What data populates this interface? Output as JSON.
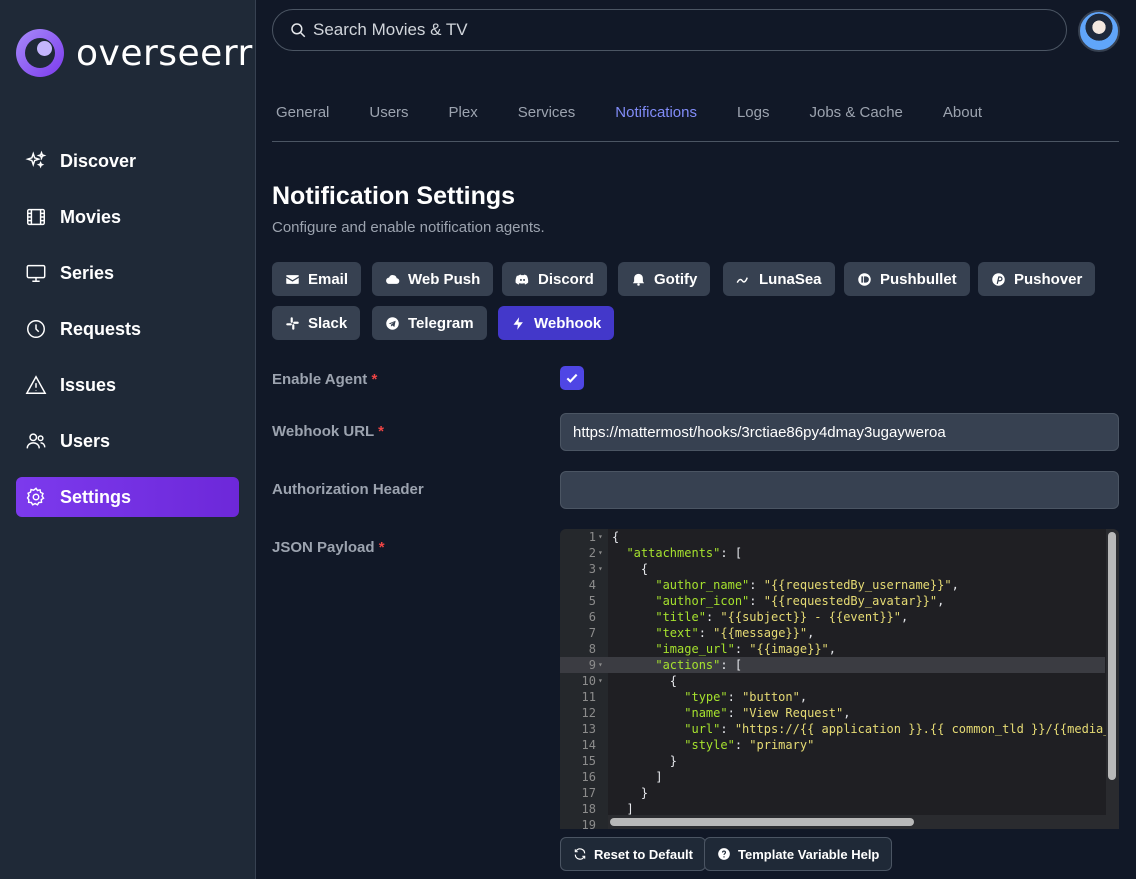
{
  "app": {
    "name": "overseerr"
  },
  "sidebar": {
    "items": [
      {
        "label": "Discover",
        "icon": "sparkles-icon"
      },
      {
        "label": "Movies",
        "icon": "film-icon"
      },
      {
        "label": "Series",
        "icon": "tv-icon"
      },
      {
        "label": "Requests",
        "icon": "clock-icon"
      },
      {
        "label": "Issues",
        "icon": "warning-icon"
      },
      {
        "label": "Users",
        "icon": "users-icon"
      },
      {
        "label": "Settings",
        "icon": "gear-icon",
        "active": true
      }
    ]
  },
  "search": {
    "placeholder": "Search Movies & TV"
  },
  "tabs": [
    {
      "label": "General"
    },
    {
      "label": "Users"
    },
    {
      "label": "Plex"
    },
    {
      "label": "Services"
    },
    {
      "label": "Notifications",
      "active": true
    },
    {
      "label": "Logs"
    },
    {
      "label": "Jobs & Cache"
    },
    {
      "label": "About"
    }
  ],
  "page": {
    "title": "Notification Settings",
    "subtitle": "Configure and enable notification agents."
  },
  "agents": [
    {
      "label": "Email",
      "icon": "mail-icon"
    },
    {
      "label": "Web Push",
      "icon": "cloud-icon"
    },
    {
      "label": "Discord",
      "icon": "discord-icon"
    },
    {
      "label": "Gotify",
      "icon": "gotify-icon"
    },
    {
      "label": "LunaSea",
      "icon": "lunasea-icon"
    },
    {
      "label": "Pushbullet",
      "icon": "pushbullet-icon"
    },
    {
      "label": "Pushover",
      "icon": "pushover-icon"
    },
    {
      "label": "Slack",
      "icon": "slack-icon"
    },
    {
      "label": "Telegram",
      "icon": "telegram-icon"
    },
    {
      "label": "Webhook",
      "icon": "lightning-icon",
      "active": true
    }
  ],
  "form": {
    "enable_agent": {
      "label": "Enable Agent",
      "required": "*",
      "checked": true
    },
    "webhook_url": {
      "label": "Webhook URL",
      "required": "*",
      "value": "https://mattermost/hooks/3rctiae86py4dmay3ugayweroa"
    },
    "authorization_header": {
      "label": "Authorization Header",
      "value": ""
    },
    "json_payload": {
      "label": "JSON Payload",
      "required": "*"
    }
  },
  "editor": {
    "highlighted_line": 9,
    "lines": [
      {
        "n": "1",
        "fold": "▾",
        "indent": "",
        "parts": [
          [
            "p",
            "{"
          ]
        ]
      },
      {
        "n": "2",
        "fold": "▾",
        "indent": "  ",
        "parts": [
          [
            "k",
            "\"attachments\""
          ],
          [
            "p",
            ": ["
          ]
        ]
      },
      {
        "n": "3",
        "fold": "▾",
        "indent": "    ",
        "parts": [
          [
            "p",
            "{"
          ]
        ]
      },
      {
        "n": "4",
        "fold": "",
        "indent": "      ",
        "parts": [
          [
            "k",
            "\"author_name\""
          ],
          [
            "p",
            ": "
          ],
          [
            "s",
            "\"{{requestedBy_username}}\""
          ],
          [
            "p",
            ","
          ]
        ]
      },
      {
        "n": "5",
        "fold": "",
        "indent": "      ",
        "parts": [
          [
            "k",
            "\"author_icon\""
          ],
          [
            "p",
            ": "
          ],
          [
            "s",
            "\"{{requestedBy_avatar}}\""
          ],
          [
            "p",
            ","
          ]
        ]
      },
      {
        "n": "6",
        "fold": "",
        "indent": "      ",
        "parts": [
          [
            "k",
            "\"title\""
          ],
          [
            "p",
            ": "
          ],
          [
            "s",
            "\"{{subject}} - {{event}}\""
          ],
          [
            "p",
            ","
          ]
        ]
      },
      {
        "n": "7",
        "fold": "",
        "indent": "      ",
        "parts": [
          [
            "k",
            "\"text\""
          ],
          [
            "p",
            ": "
          ],
          [
            "s",
            "\"{{message}}\""
          ],
          [
            "p",
            ","
          ]
        ]
      },
      {
        "n": "8",
        "fold": "",
        "indent": "      ",
        "parts": [
          [
            "k",
            "\"image_url\""
          ],
          [
            "p",
            ": "
          ],
          [
            "s",
            "\"{{image}}\""
          ],
          [
            "p",
            ","
          ]
        ]
      },
      {
        "n": "9",
        "fold": "▾",
        "indent": "      ",
        "parts": [
          [
            "k",
            "\"actions\""
          ],
          [
            "p",
            ": ["
          ]
        ]
      },
      {
        "n": "10",
        "fold": "▾",
        "indent": "        ",
        "parts": [
          [
            "p",
            "{"
          ]
        ]
      },
      {
        "n": "11",
        "fold": "",
        "indent": "          ",
        "parts": [
          [
            "k",
            "\"type\""
          ],
          [
            "p",
            ": "
          ],
          [
            "s",
            "\"button\""
          ],
          [
            "p",
            ","
          ]
        ]
      },
      {
        "n": "12",
        "fold": "",
        "indent": "          ",
        "parts": [
          [
            "k",
            "\"name\""
          ],
          [
            "p",
            ": "
          ],
          [
            "s",
            "\"View Request\""
          ],
          [
            "p",
            ","
          ]
        ]
      },
      {
        "n": "13",
        "fold": "",
        "indent": "          ",
        "parts": [
          [
            "k",
            "\"url\""
          ],
          [
            "p",
            ": "
          ],
          [
            "s",
            "\"https://{{ application }}.{{ common_tld }}/{{media_"
          ]
        ]
      },
      {
        "n": "14",
        "fold": "",
        "indent": "          ",
        "parts": [
          [
            "k",
            "\"style\""
          ],
          [
            "p",
            ": "
          ],
          [
            "s",
            "\"primary\""
          ]
        ]
      },
      {
        "n": "15",
        "fold": "",
        "indent": "        ",
        "parts": [
          [
            "p",
            "}"
          ]
        ]
      },
      {
        "n": "16",
        "fold": "",
        "indent": "      ",
        "parts": [
          [
            "p",
            "]"
          ]
        ]
      },
      {
        "n": "17",
        "fold": "",
        "indent": "    ",
        "parts": [
          [
            "p",
            "}"
          ]
        ]
      },
      {
        "n": "18",
        "fold": "",
        "indent": "  ",
        "parts": [
          [
            "p",
            "]"
          ]
        ]
      },
      {
        "n": "19",
        "fold": "",
        "indent": "",
        "parts": [
          [
            "p",
            ""
          ]
        ]
      }
    ]
  },
  "actions": {
    "reset_label": "Reset to Default",
    "help_label": "Template Variable Help"
  },
  "colors": {
    "accent": "#4338ca",
    "sidebar_active": "#7c3aed",
    "tab_active": "#818cf8",
    "required": "#ef4444"
  }
}
